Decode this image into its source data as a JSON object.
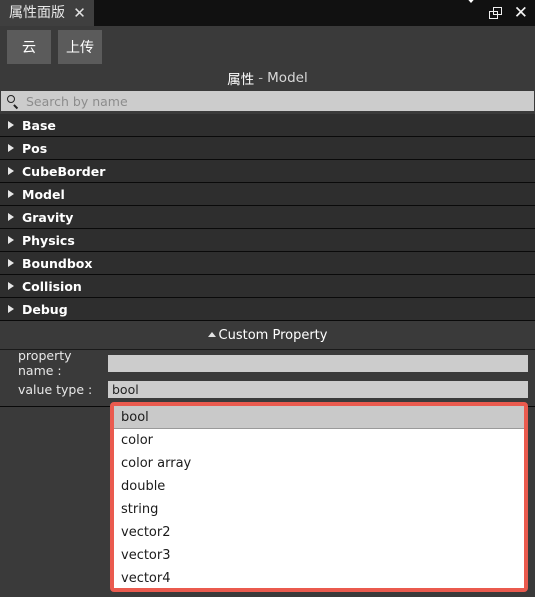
{
  "titlebar": {
    "tab_label": "属性面版",
    "close_glyph": "✕",
    "controls": {
      "dropdown_icon": "chevron-down-icon",
      "restore_icon": "restore-window-icon",
      "close_icon": "close-icon",
      "close_glyph": "✕"
    }
  },
  "toolbar": {
    "buttons": [
      {
        "label": "云",
        "name": "cloud-button"
      },
      {
        "label": "上传",
        "name": "upload-button"
      }
    ]
  },
  "panel_title": {
    "cn": "属性",
    "dash": "-",
    "en": "Model"
  },
  "search": {
    "icon": "search-icon",
    "placeholder": "Search by name",
    "value": ""
  },
  "sections": [
    {
      "label": "Base"
    },
    {
      "label": "Pos"
    },
    {
      "label": "CubeBorder"
    },
    {
      "label": "Model"
    },
    {
      "label": "Gravity"
    },
    {
      "label": "Physics"
    },
    {
      "label": "Boundbox"
    },
    {
      "label": "Collision"
    },
    {
      "label": "Debug"
    }
  ],
  "custom_property": {
    "header": "Custom Property",
    "collapse_icon": "caret-up-icon",
    "property_name_label": "property name :",
    "property_name_value": "",
    "property_name_placeholder": "",
    "value_type_label": "value type :",
    "value_type_selected": "bool"
  },
  "dropdown": {
    "selected": "bool",
    "options": [
      "bool",
      "color",
      "color array",
      "double",
      "string",
      "vector2",
      "vector3",
      "vector4"
    ],
    "border_color": "#ea5a4e"
  }
}
